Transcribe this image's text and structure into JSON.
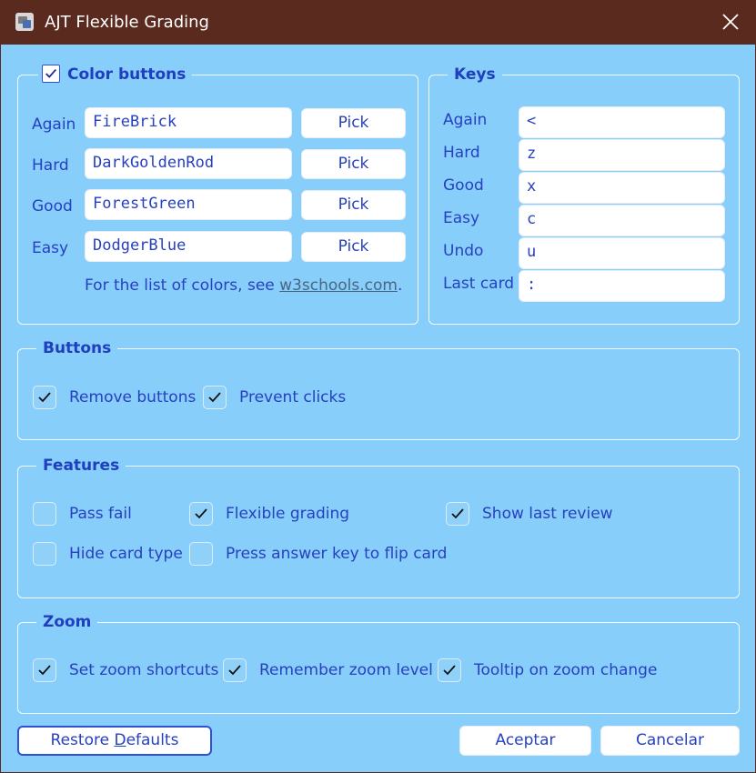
{
  "window": {
    "title": "AJT Flexible Grading"
  },
  "color_buttons": {
    "title": "Color buttons",
    "enabled": true,
    "rows": [
      {
        "label": "Again",
        "value": "FireBrick",
        "pick_label": "Pick"
      },
      {
        "label": "Hard",
        "value": "DarkGoldenRod",
        "pick_label": "Pick"
      },
      {
        "label": "Good",
        "value": "ForestGreen",
        "pick_label": "Pick"
      },
      {
        "label": "Easy",
        "value": "DodgerBlue",
        "pick_label": "Pick"
      }
    ],
    "note_prefix": "For the list of colors, see ",
    "note_link": "w3schools.com",
    "note_suffix": "."
  },
  "keys": {
    "title": "Keys",
    "rows": [
      {
        "label": "Again",
        "value": "<"
      },
      {
        "label": "Hard",
        "value": "z"
      },
      {
        "label": "Good",
        "value": "x"
      },
      {
        "label": "Easy",
        "value": "c"
      },
      {
        "label": "Undo",
        "value": "u"
      },
      {
        "label": "Last card",
        "value": ":"
      }
    ]
  },
  "buttons_group": {
    "title": "Buttons",
    "options": [
      {
        "label": "Remove buttons",
        "checked": true
      },
      {
        "label": "Prevent clicks",
        "checked": true
      }
    ]
  },
  "features": {
    "title": "Features",
    "options": [
      {
        "label": "Pass fail",
        "checked": false
      },
      {
        "label": "Flexible grading",
        "checked": true
      },
      {
        "label": "Show last review",
        "checked": true
      },
      {
        "label": "Hide card type",
        "checked": false
      },
      {
        "label": "Press answer key to flip card",
        "checked": false
      }
    ]
  },
  "zoom": {
    "title": "Zoom",
    "options": [
      {
        "label": "Set zoom shortcuts",
        "checked": true
      },
      {
        "label": "Remember zoom level",
        "checked": true
      },
      {
        "label": "Tooltip on zoom change",
        "checked": true
      }
    ]
  },
  "footer": {
    "restore_prefix": "Restore ",
    "restore_underlined": "D",
    "restore_suffix": "efaults",
    "accept_label": "Aceptar",
    "cancel_label": "Cancelar"
  },
  "colors": {
    "background": "#87cefa",
    "titlebar": "#5a2a1e",
    "text": "#2740c0",
    "heading": "#1f3fbf"
  }
}
